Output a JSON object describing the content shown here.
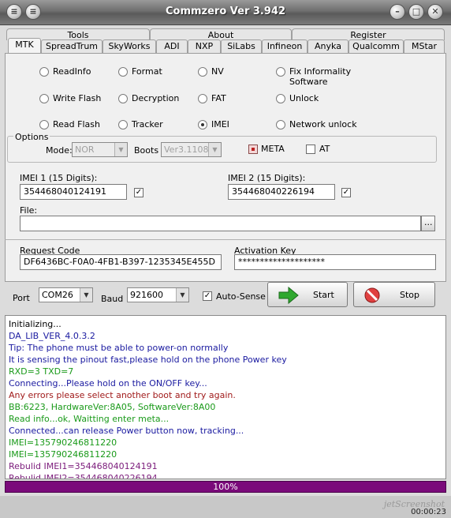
{
  "window": {
    "title": "Commzero Ver 3.942"
  },
  "tabs_upper": [
    "Tools",
    "About",
    "Register"
  ],
  "tabs_lower": [
    "MTK",
    "SpreadTrum",
    "SkyWorks",
    "ADI",
    "NXP",
    "SiLabs",
    "Infineon",
    "Anyka",
    "Qualcomm",
    "MStar"
  ],
  "functions": [
    [
      "ReadInfo",
      "Format",
      "NV",
      "Fix Informality Software"
    ],
    [
      "Write Flash",
      "Decryption",
      "FAT",
      "Unlock"
    ],
    [
      "Read Flash",
      "Tracker",
      "IMEI",
      "Network unlock"
    ]
  ],
  "selected_function": "IMEI",
  "options": {
    "legend": "Options",
    "mode_label": "Mode:",
    "mode_value": "NOR",
    "boots_label": "Boots",
    "boots_value": "Ver3.1108",
    "meta_label": "META",
    "at_label": "AT"
  },
  "imei": {
    "imei1_label": "IMEI 1 (15 Digits):",
    "imei1_value": "354468040124191",
    "imei2_label": "IMEI 2 (15 Digits):",
    "imei2_value": "354468040226194",
    "file_label": "File:",
    "browse_label": "..."
  },
  "codes": {
    "request_label": "Request Code",
    "request_value": "DF6436BC-F0A0-4FB1-B397-1235345E455D",
    "activation_label": "Activation Key",
    "activation_value": "********************"
  },
  "connection": {
    "port_label": "Port",
    "port_value": "COM26",
    "baud_label": "Baud",
    "baud_value": "921600",
    "autosense_label": "Auto-Sense",
    "start_label": "Start",
    "stop_label": "Stop"
  },
  "log": [
    {
      "text": "Initializing...",
      "color": "#000000"
    },
    {
      "text": "DA_LIB_VER_4.0.3.2",
      "color": "#1a1aa0"
    },
    {
      "text": "Tip: The phone must be able to power-on normally",
      "color": "#1a1aa0"
    },
    {
      "text": "It is sensing the pinout fast,please hold on the phone Power key",
      "color": "#1a1aa0"
    },
    {
      "text": "RXD=3  TXD=7",
      "color": "#1a9a1a"
    },
    {
      "text": "Connecting...Please hold on the ON/OFF key...",
      "color": "#1a1aa0"
    },
    {
      "text": "Any errors please select another boot and try again.",
      "color": "#a01a1a"
    },
    {
      "text": "BB:6223,     HardwareVer:8A05,     SoftwareVer:8A00",
      "color": "#1a9a1a"
    },
    {
      "text": "Read info...ok, Waitting enter meta...",
      "color": "#1a9a1a"
    },
    {
      "text": "Connected...can release Power button now, tracking...",
      "color": "#1a1aa0"
    },
    {
      "text": "IMEI=135790246811220",
      "color": "#1a9a1a"
    },
    {
      "text": "IMEI=135790246811220",
      "color": "#1a9a1a"
    },
    {
      "text": "Rebulid IMEI1=354468040124191",
      "color": "#7a1a7a"
    },
    {
      "text": "Rebulid IMEI2=354468040226194",
      "color": "#7a1a7a"
    }
  ],
  "progress": {
    "label": "100%",
    "value": 1.0
  },
  "status": {
    "timer": "00:00:23"
  },
  "watermark": "jetScreenshot"
}
